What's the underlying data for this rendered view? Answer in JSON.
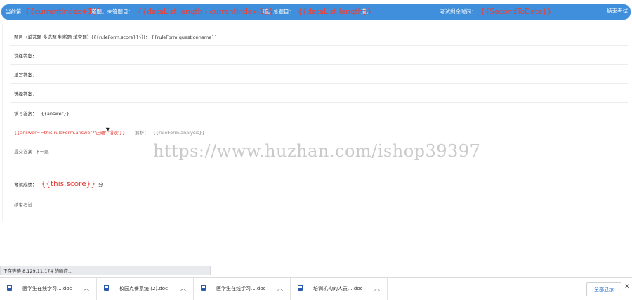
{
  "header": {
    "prefix": "当前第",
    "current_index": "{{currentIndex+1}}",
    "text_unanswered": "道题。未答题目：",
    "remaining": "{{dataList.length - currentIndex-1}}",
    "text_total": "道。总题目：",
    "total": "{{dataList.length}}",
    "text_end": "道。",
    "time_label": "考试剩余时间：",
    "time_value": "{{SecondToDate}}",
    "end_exam": "结束考试"
  },
  "question": {
    "title": "题目（单选题 多选题 判断题 填空题）({{ruleForm.score}}分)：  {{ruleForm.questionname}}",
    "choice_answer_1": "选择答案：",
    "fill_answer_1": "填写答案：",
    "choice_answer_2": "选择答案：",
    "fill_answer_2": "填写答案：",
    "fill_answer_value": "{{answer}}",
    "result_expr": "{{answer==this.ruleForm.answer?'正确':'错误'}}",
    "analysis_label": "解析：",
    "analysis_value": "{{ruleForm.analysis}}",
    "submit": "提交答案",
    "next": "下一题",
    "score_label": "考试成绩：",
    "score_value": "{{this.score}}",
    "score_unit": "分",
    "end_exam": "结束考试"
  },
  "watermark": "https://www.huzhan.com/ishop39397",
  "status_text": "正在等待 8.129.11.174 的响应...",
  "downloads": [
    {
      "name": "医学生在线学习....doc"
    },
    {
      "name": "校园点餐系统 (2).doc"
    },
    {
      "name": "医学生在线学习....doc"
    },
    {
      "name": "培训机构的人员....doc"
    }
  ],
  "show_all": "全部显示",
  "colors": {
    "header_bg": "#3f8fdc",
    "accent_red": "#e33a31",
    "link_blue": "#1a66cc"
  }
}
